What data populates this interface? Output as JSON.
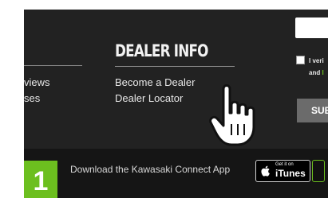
{
  "left_column": {
    "link_1": "views",
    "link_2": "ses"
  },
  "dealer_info": {
    "title": "DEALER INFO",
    "links": [
      "Become a Dealer",
      "Dealer Locator"
    ]
  },
  "newsletter": {
    "verify_line_1": "I veri",
    "verify_line_2_prefix": "and",
    "verify_line_2_link": "I",
    "submit_label": "SUB"
  },
  "app_bar": {
    "step_number": "1",
    "download_text": "Download the Kawasaki Connect App",
    "itunes_small": "Get it on",
    "itunes_label": "iTunes"
  },
  "colors": {
    "background": "#222222",
    "accent_green": "#6cbf1f"
  },
  "icons": [
    "apple-icon",
    "hand-pointer-cursor-icon"
  ]
}
